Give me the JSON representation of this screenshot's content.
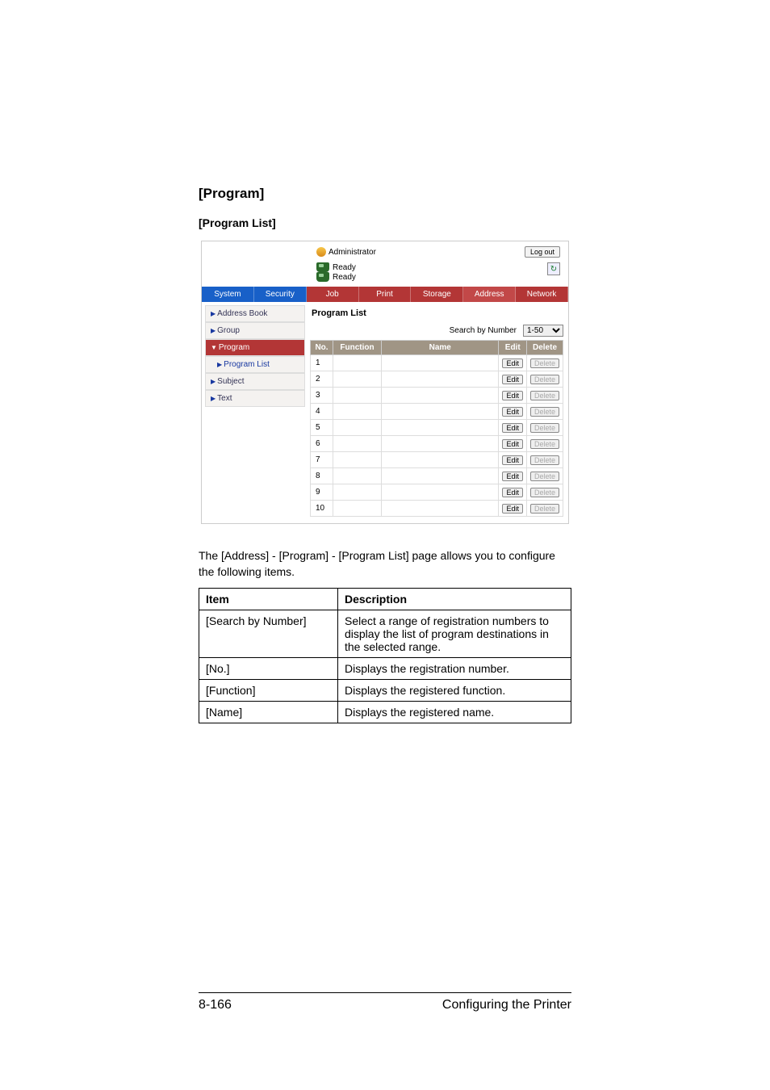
{
  "headings": {
    "h1": "[Program]",
    "h2": "[Program List]"
  },
  "screenshot": {
    "administrator": "Administrator",
    "logout": "Log out",
    "status1": "Ready",
    "status2": "Ready",
    "tabs": {
      "system": "System",
      "security": "Security",
      "job": "Job",
      "print": "Print",
      "storage": "Storage",
      "address": "Address",
      "network": "Network"
    },
    "sidebar": {
      "address_book": "Address Book",
      "group": "Group",
      "program": "Program",
      "program_list": "Program List",
      "subject": "Subject",
      "text": "Text"
    },
    "main_title": "Program List",
    "search_label": "Search by Number",
    "search_value": "1-50",
    "columns": {
      "no": "No.",
      "function": "Function",
      "name": "Name",
      "edit": "Edit",
      "delete": "Delete"
    },
    "rows": [
      {
        "no": "1"
      },
      {
        "no": "2"
      },
      {
        "no": "3"
      },
      {
        "no": "4"
      },
      {
        "no": "5"
      },
      {
        "no": "6"
      },
      {
        "no": "7"
      },
      {
        "no": "8"
      },
      {
        "no": "9"
      },
      {
        "no": "10"
      }
    ],
    "edit_btn": "Edit",
    "delete_btn": "Delete"
  },
  "description": "The [Address] - [Program] - [Program List] page allows you to configure the following items.",
  "table": {
    "header_item": "Item",
    "header_desc": "Description",
    "rows": [
      {
        "item": "[Search by Number]",
        "desc": "Select a range of registration numbers to display the list of program destinations in the selected range."
      },
      {
        "item": "[No.]",
        "desc": "Displays the registration number."
      },
      {
        "item": "[Function]",
        "desc": "Displays the registered function."
      },
      {
        "item": "[Name]",
        "desc": "Displays the registered name."
      }
    ]
  },
  "footer": {
    "page": "8-166",
    "title": "Configuring the Printer"
  }
}
